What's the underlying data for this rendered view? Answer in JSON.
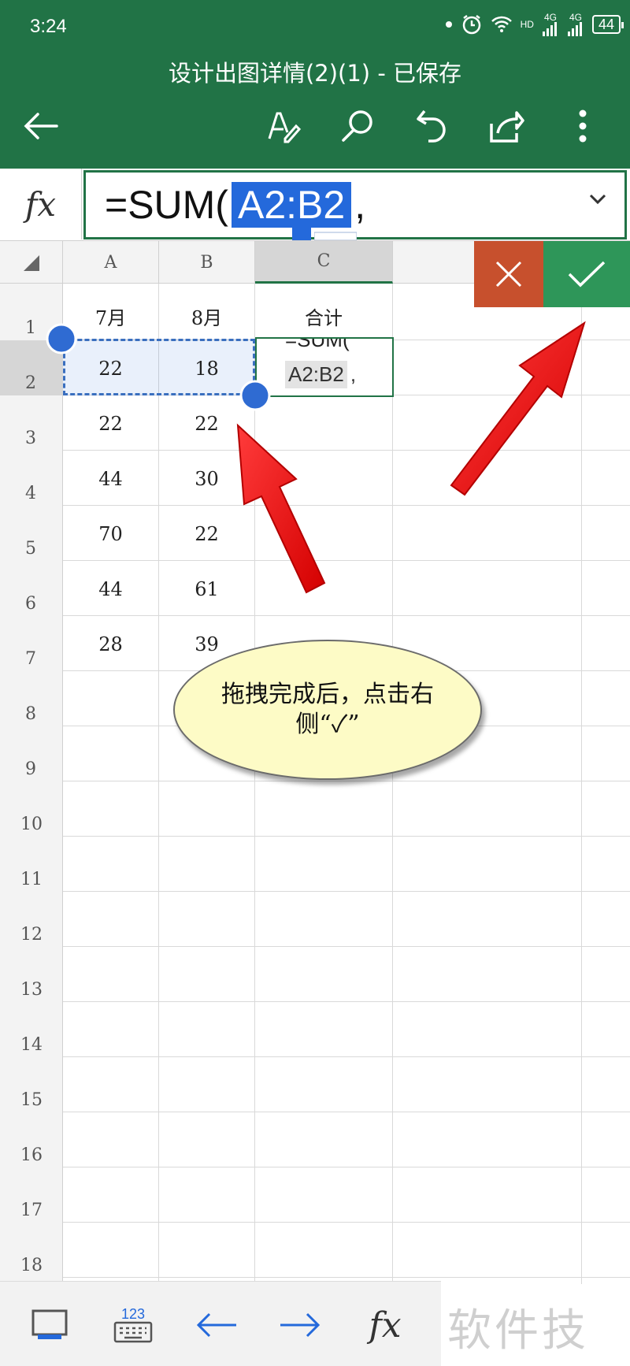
{
  "status_bar": {
    "time": "3:24",
    "network_1": "4G",
    "network_2": "4G",
    "hd": "HD",
    "battery": "44"
  },
  "header": {
    "title": "设计出图详情(2)(1) - 已保存"
  },
  "toolbar": {
    "icons": [
      "back-arrow-icon",
      "draw-pen-icon",
      "search-icon",
      "undo-icon",
      "share-icon",
      "more-vertical-icon"
    ]
  },
  "formula_bar": {
    "fx": "fx",
    "prefix": "=SUM(",
    "reference": "A2:B2",
    "suffix": ","
  },
  "columns": [
    "A",
    "B",
    "C"
  ],
  "rows": [
    "1",
    "2",
    "3",
    "4",
    "5",
    "6",
    "7",
    "8",
    "9",
    "10",
    "11",
    "12",
    "13",
    "14",
    "15",
    "16",
    "17",
    "18"
  ],
  "cells": {
    "a1": "7月",
    "b1": "8月",
    "c1": "合计",
    "a2": "22",
    "b2": "18",
    "a3": "22",
    "b3": "22",
    "a4": "44",
    "b4": "30",
    "a5": "70",
    "b5": "22",
    "a6": "44",
    "b6": "61",
    "a7": "28",
    "b7": "39",
    "c2_line1": "=SUM(",
    "c2_ref": "A2:B2",
    "c2_suffix": ","
  },
  "callout": {
    "text": "拖拽完成后，点击右侧“✓”"
  },
  "bottom_bar": {
    "keyboard_label": "123",
    "fx": "fx"
  },
  "watermark": "软件技巧",
  "colors": {
    "excel_green": "#217346",
    "cancel_red": "#c7502d",
    "confirm_green": "#2e9659",
    "selection_blue": "#2469db"
  }
}
